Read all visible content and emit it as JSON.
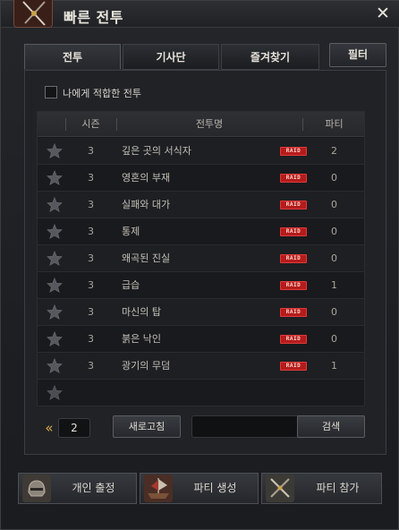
{
  "window": {
    "title": "빠른 전투",
    "close_label": "✕"
  },
  "tabs": [
    {
      "label": "전투",
      "active": true
    },
    {
      "label": "기사단",
      "active": false
    },
    {
      "label": "즐겨찾기",
      "active": false
    }
  ],
  "filter_label": "필터",
  "checkbox": {
    "label": "나에게 적합한 전투",
    "checked": false
  },
  "table": {
    "headers": {
      "season": "시즌",
      "name": "전투명",
      "party": "파티"
    },
    "badge_text": "RAID",
    "rows": [
      {
        "season": "3",
        "name": "깊은 곳의 서식자",
        "party": "2"
      },
      {
        "season": "3",
        "name": "영혼의 부재",
        "party": "0"
      },
      {
        "season": "3",
        "name": "실패와 대가",
        "party": "0"
      },
      {
        "season": "3",
        "name": "통제",
        "party": "0"
      },
      {
        "season": "3",
        "name": "왜곡된 진실",
        "party": "0"
      },
      {
        "season": "3",
        "name": "급습",
        "party": "1"
      },
      {
        "season": "3",
        "name": "마신의 탑",
        "party": "0"
      },
      {
        "season": "3",
        "name": "붉은 낙인",
        "party": "0"
      },
      {
        "season": "3",
        "name": "광기의 무덤",
        "party": "1"
      }
    ]
  },
  "pager": {
    "prev": "«",
    "page": "2",
    "next": "»"
  },
  "refresh_label": "새로고침",
  "search": {
    "value": "",
    "button_label": "검색"
  },
  "bottom_buttons": [
    {
      "label": "개인 출정",
      "icon": "helmet-icon"
    },
    {
      "label": "파티 생성",
      "icon": "ship-icon"
    },
    {
      "label": "파티 참가",
      "icon": "crossed-swords-icon"
    }
  ],
  "colors": {
    "raid_badge": "#b41c1c",
    "pager_arrow": "#d6a84a",
    "star": "#55585d"
  }
}
